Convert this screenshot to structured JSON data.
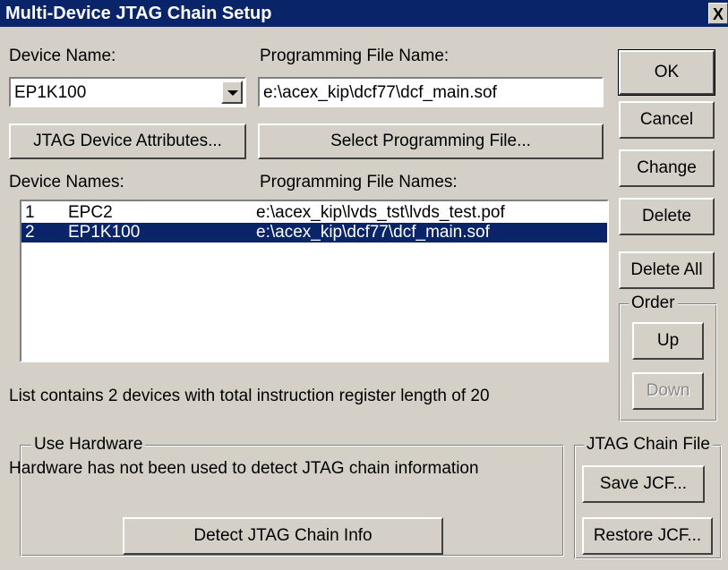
{
  "window": {
    "title": "Multi-Device JTAG Chain Setup",
    "close_glyph": "X"
  },
  "device_name": {
    "label": "Device Name:",
    "value": "EP1K100"
  },
  "programming_file": {
    "label": "Programming File Name:",
    "value": "e:\\acex_kip\\dcf77\\dcf_main.sof"
  },
  "buttons": {
    "jtag_attributes": "JTAG Device Attributes...",
    "select_file": "Select Programming File...",
    "ok": "OK",
    "cancel": "Cancel",
    "change": "Change",
    "delete": "Delete",
    "delete_all": "Delete All",
    "up": "Up",
    "down": "Down",
    "detect": "Detect JTAG Chain Info",
    "save_jcf": "Save JCF...",
    "restore_jcf": "Restore JCF..."
  },
  "list": {
    "col_device": "Device Names:",
    "col_file": "Programming File Names:",
    "rows": [
      {
        "num": "1",
        "device": "EPC2",
        "file": "e:\\acex_kip\\lvds_tst\\lvds_test.pof",
        "selected": false
      },
      {
        "num": "2",
        "device": "EP1K100",
        "file": "e:\\acex_kip\\dcf77\\dcf_main.sof",
        "selected": true
      }
    ],
    "summary": "List contains 2 devices with total instruction register length of 20"
  },
  "order_group": {
    "title": "Order"
  },
  "hardware_group": {
    "title": "Use Hardware",
    "message": "Hardware has not been used to detect JTAG chain information"
  },
  "jcf_group": {
    "title": "JTAG Chain File"
  },
  "colors": {
    "face": "#d4d0c8",
    "title_bar": "#0a246a",
    "selection": "#0a246a"
  }
}
